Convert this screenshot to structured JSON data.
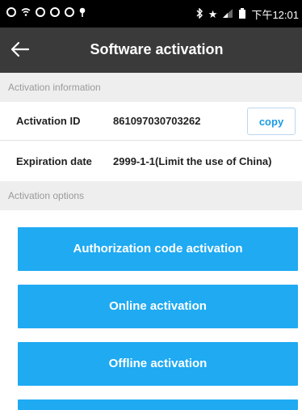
{
  "status_bar": {
    "time": "下午12:01",
    "icons": [
      "notification-icon",
      "wifi-icon",
      "sync-icon",
      "clock-icon",
      "settings-icon",
      "location-icon",
      "bluetooth-icon",
      "star-icon",
      "signal-icon",
      "battery-icon"
    ]
  },
  "app_bar": {
    "back_icon": "arrow-left-icon",
    "title": "Software activation"
  },
  "sections": {
    "info_header": "Activation information",
    "options_header": "Activation options"
  },
  "info": {
    "activation_id_label": "Activation ID",
    "activation_id_value": "861097030703262",
    "copy_label": "copy",
    "expiration_label": "Expiration date",
    "expiration_value": "2999-1-1(Limit the use of China)"
  },
  "buttons": {
    "auth_code": "Authorization code activation",
    "online": "Online activation",
    "offline": "Offline activation"
  },
  "colors": {
    "app_bar": "#3a3a3a",
    "accent": "#1faaf2",
    "link": "#1b9be6"
  }
}
